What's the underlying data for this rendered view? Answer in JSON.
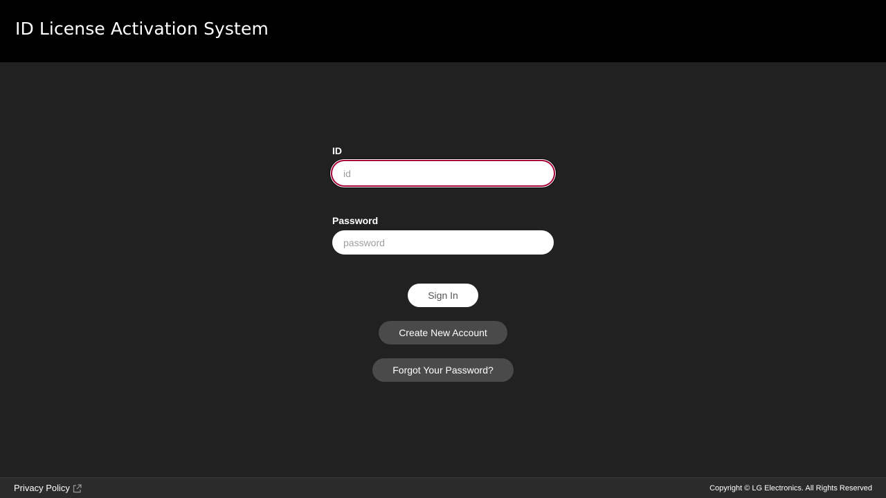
{
  "header": {
    "title": "ID License Activation System"
  },
  "login_form": {
    "id_label": "ID",
    "id_placeholder": "id",
    "id_value": "",
    "password_label": "Password",
    "password_placeholder": "password",
    "password_value": "",
    "sign_in_label": "Sign In",
    "create_account_label": "Create New Account",
    "forgot_password_label": "Forgot Your Password?"
  },
  "footer": {
    "privacy_policy_label": "Privacy Policy",
    "privacy_icon": "external-link-icon",
    "copyright": "Copyright © LG Electronics. All Rights Reserved"
  },
  "colors": {
    "header_bg": "#000000",
    "page_bg": "#212121",
    "focus_ring": "#a50034",
    "secondary_button_bg": "#4a4a4a",
    "footer_bg": "#2b2b2b"
  }
}
